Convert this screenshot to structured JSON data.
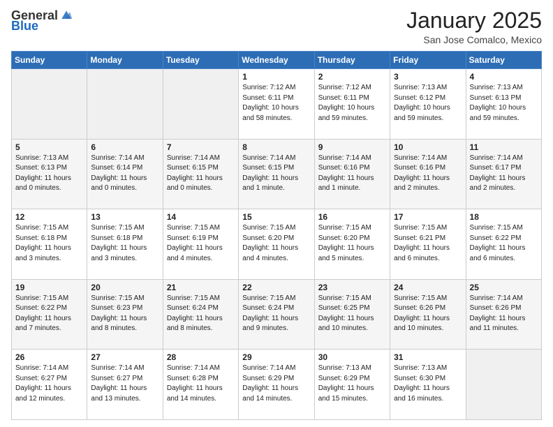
{
  "header": {
    "logo_general": "General",
    "logo_blue": "Blue",
    "month": "January 2025",
    "location": "San Jose Comalco, Mexico"
  },
  "weekdays": [
    "Sunday",
    "Monday",
    "Tuesday",
    "Wednesday",
    "Thursday",
    "Friday",
    "Saturday"
  ],
  "weeks": [
    [
      {
        "day": "",
        "info": ""
      },
      {
        "day": "",
        "info": ""
      },
      {
        "day": "",
        "info": ""
      },
      {
        "day": "1",
        "info": "Sunrise: 7:12 AM\nSunset: 6:11 PM\nDaylight: 10 hours\nand 58 minutes."
      },
      {
        "day": "2",
        "info": "Sunrise: 7:12 AM\nSunset: 6:11 PM\nDaylight: 10 hours\nand 59 minutes."
      },
      {
        "day": "3",
        "info": "Sunrise: 7:13 AM\nSunset: 6:12 PM\nDaylight: 10 hours\nand 59 minutes."
      },
      {
        "day": "4",
        "info": "Sunrise: 7:13 AM\nSunset: 6:13 PM\nDaylight: 10 hours\nand 59 minutes."
      }
    ],
    [
      {
        "day": "5",
        "info": "Sunrise: 7:13 AM\nSunset: 6:13 PM\nDaylight: 11 hours\nand 0 minutes."
      },
      {
        "day": "6",
        "info": "Sunrise: 7:14 AM\nSunset: 6:14 PM\nDaylight: 11 hours\nand 0 minutes."
      },
      {
        "day": "7",
        "info": "Sunrise: 7:14 AM\nSunset: 6:15 PM\nDaylight: 11 hours\nand 0 minutes."
      },
      {
        "day": "8",
        "info": "Sunrise: 7:14 AM\nSunset: 6:15 PM\nDaylight: 11 hours\nand 1 minute."
      },
      {
        "day": "9",
        "info": "Sunrise: 7:14 AM\nSunset: 6:16 PM\nDaylight: 11 hours\nand 1 minute."
      },
      {
        "day": "10",
        "info": "Sunrise: 7:14 AM\nSunset: 6:16 PM\nDaylight: 11 hours\nand 2 minutes."
      },
      {
        "day": "11",
        "info": "Sunrise: 7:14 AM\nSunset: 6:17 PM\nDaylight: 11 hours\nand 2 minutes."
      }
    ],
    [
      {
        "day": "12",
        "info": "Sunrise: 7:15 AM\nSunset: 6:18 PM\nDaylight: 11 hours\nand 3 minutes."
      },
      {
        "day": "13",
        "info": "Sunrise: 7:15 AM\nSunset: 6:18 PM\nDaylight: 11 hours\nand 3 minutes."
      },
      {
        "day": "14",
        "info": "Sunrise: 7:15 AM\nSunset: 6:19 PM\nDaylight: 11 hours\nand 4 minutes."
      },
      {
        "day": "15",
        "info": "Sunrise: 7:15 AM\nSunset: 6:20 PM\nDaylight: 11 hours\nand 4 minutes."
      },
      {
        "day": "16",
        "info": "Sunrise: 7:15 AM\nSunset: 6:20 PM\nDaylight: 11 hours\nand 5 minutes."
      },
      {
        "day": "17",
        "info": "Sunrise: 7:15 AM\nSunset: 6:21 PM\nDaylight: 11 hours\nand 6 minutes."
      },
      {
        "day": "18",
        "info": "Sunrise: 7:15 AM\nSunset: 6:22 PM\nDaylight: 11 hours\nand 6 minutes."
      }
    ],
    [
      {
        "day": "19",
        "info": "Sunrise: 7:15 AM\nSunset: 6:22 PM\nDaylight: 11 hours\nand 7 minutes."
      },
      {
        "day": "20",
        "info": "Sunrise: 7:15 AM\nSunset: 6:23 PM\nDaylight: 11 hours\nand 8 minutes."
      },
      {
        "day": "21",
        "info": "Sunrise: 7:15 AM\nSunset: 6:24 PM\nDaylight: 11 hours\nand 8 minutes."
      },
      {
        "day": "22",
        "info": "Sunrise: 7:15 AM\nSunset: 6:24 PM\nDaylight: 11 hours\nand 9 minutes."
      },
      {
        "day": "23",
        "info": "Sunrise: 7:15 AM\nSunset: 6:25 PM\nDaylight: 11 hours\nand 10 minutes."
      },
      {
        "day": "24",
        "info": "Sunrise: 7:15 AM\nSunset: 6:26 PM\nDaylight: 11 hours\nand 10 minutes."
      },
      {
        "day": "25",
        "info": "Sunrise: 7:14 AM\nSunset: 6:26 PM\nDaylight: 11 hours\nand 11 minutes."
      }
    ],
    [
      {
        "day": "26",
        "info": "Sunrise: 7:14 AM\nSunset: 6:27 PM\nDaylight: 11 hours\nand 12 minutes."
      },
      {
        "day": "27",
        "info": "Sunrise: 7:14 AM\nSunset: 6:27 PM\nDaylight: 11 hours\nand 13 minutes."
      },
      {
        "day": "28",
        "info": "Sunrise: 7:14 AM\nSunset: 6:28 PM\nDaylight: 11 hours\nand 14 minutes."
      },
      {
        "day": "29",
        "info": "Sunrise: 7:14 AM\nSunset: 6:29 PM\nDaylight: 11 hours\nand 14 minutes."
      },
      {
        "day": "30",
        "info": "Sunrise: 7:13 AM\nSunset: 6:29 PM\nDaylight: 11 hours\nand 15 minutes."
      },
      {
        "day": "31",
        "info": "Sunrise: 7:13 AM\nSunset: 6:30 PM\nDaylight: 11 hours\nand 16 minutes."
      },
      {
        "day": "",
        "info": ""
      }
    ]
  ]
}
